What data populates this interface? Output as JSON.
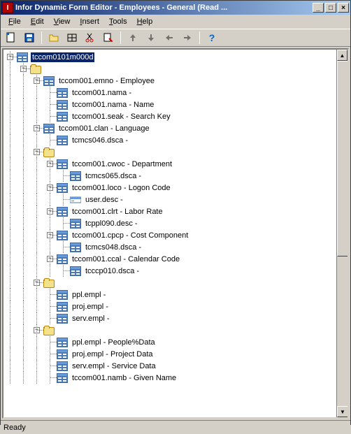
{
  "window": {
    "title": "Infor Dynamic Form Editor - Employees - General (Read ..."
  },
  "menu": {
    "file": "File",
    "edit": "Edit",
    "view": "View",
    "insert": "Insert",
    "tools": "Tools",
    "help": "Help"
  },
  "toolbar": {
    "new": "new",
    "save": "save",
    "open": "open",
    "grid": "grid",
    "cut": "cut",
    "props": "properties",
    "up": "up",
    "down": "down",
    "left": "left",
    "right": "right",
    "help": "?"
  },
  "tree": {
    "root": "tccom0101m000d",
    "n1": "tccom001.emno - Employee",
    "n1a": "tccom001.nama -",
    "n1b": "tccom001.nama - Name",
    "n1c": "tccom001.seak - Search Key",
    "n2": "tccom001.clan - Language",
    "n2a": "tcmcs046.dsca -",
    "n3a": "tccom001.cwoc - Department",
    "n3a1": "tcmcs065.dsca -",
    "n3b": "tccom001.loco - Logon Code",
    "n3b1": "user.desc -",
    "n3c": "tccom001.clrt - Labor Rate",
    "n3c1": "tcppl090.desc -",
    "n3d": "tccom001.cpcp - Cost Component",
    "n3d1": "tcmcs048.dsca -",
    "n3e": "tccom001.ccal - Calendar Code",
    "n3e1": "tcccp010.dsca -",
    "n4a": "ppl.empl -",
    "n4b": "proj.empl -",
    "n4c": "serv.empl -",
    "n5a": "ppl.empl - People%Data",
    "n5b": "proj.empl - Project Data",
    "n5c": "serv.empl - Service Data",
    "n5d": "tccom001.namb - Given Name"
  },
  "status": {
    "text": "Ready"
  }
}
